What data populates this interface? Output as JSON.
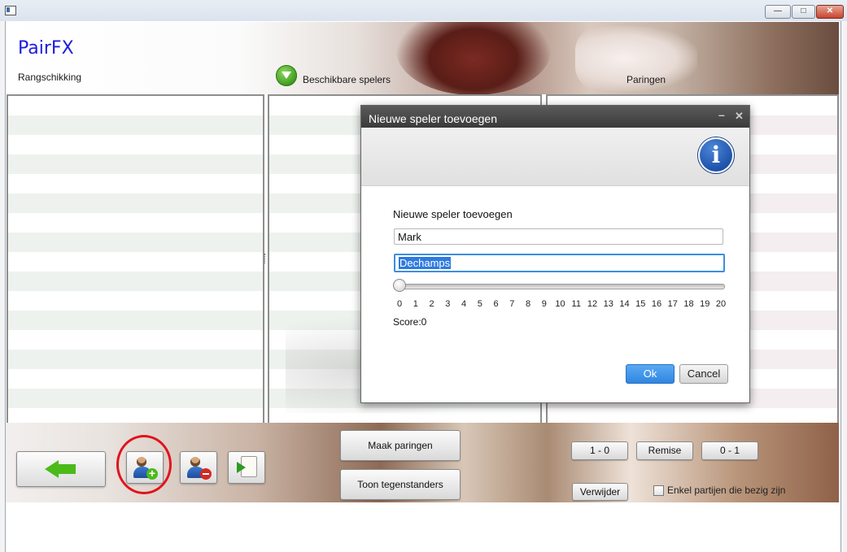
{
  "window": {
    "minimize_glyph": "—",
    "maximize_glyph": "□",
    "close_glyph": "✕"
  },
  "app": {
    "title": "PairFX",
    "headers": {
      "ranking": "Rangschikking",
      "available_players": "Beschikbare spelers",
      "pairings": "Paringen"
    }
  },
  "toolbar": {
    "icons": {
      "back": "back-arrow-icon",
      "add_player": "add-player-icon",
      "remove_player": "remove-player-icon",
      "export": "export-icon"
    },
    "make_pairings": "Maak paringen",
    "show_opponents": "Toon tegenstanders",
    "result_white": "1 - 0",
    "result_draw": "Remise",
    "result_black": "0 - 1",
    "delete": "Verwijder",
    "only_active": "Enkel partijen die bezig zijn",
    "only_active_checked": false
  },
  "dialog": {
    "title": "Nieuwe speler toevoegen",
    "prompt": "Nieuwe speler toevoegen",
    "first_name": "Mark",
    "last_name": "Dechamps",
    "slider": {
      "min": 0,
      "max": 20,
      "value": 0,
      "ticks": [
        "0",
        "1",
        "2",
        "3",
        "4",
        "5",
        "6",
        "7",
        "8",
        "9",
        "10",
        "11",
        "12",
        "13",
        "14",
        "15",
        "16",
        "17",
        "18",
        "19",
        "20"
      ]
    },
    "score_label": "Score:0",
    "ok": "Ok",
    "cancel": "Cancel",
    "info_glyph": "i"
  },
  "colors": {
    "title_blue": "#1d1de0",
    "highlight_red": "#e0141c",
    "ok_blue": "#2f86e0",
    "green_accent": "#4cba1a"
  }
}
